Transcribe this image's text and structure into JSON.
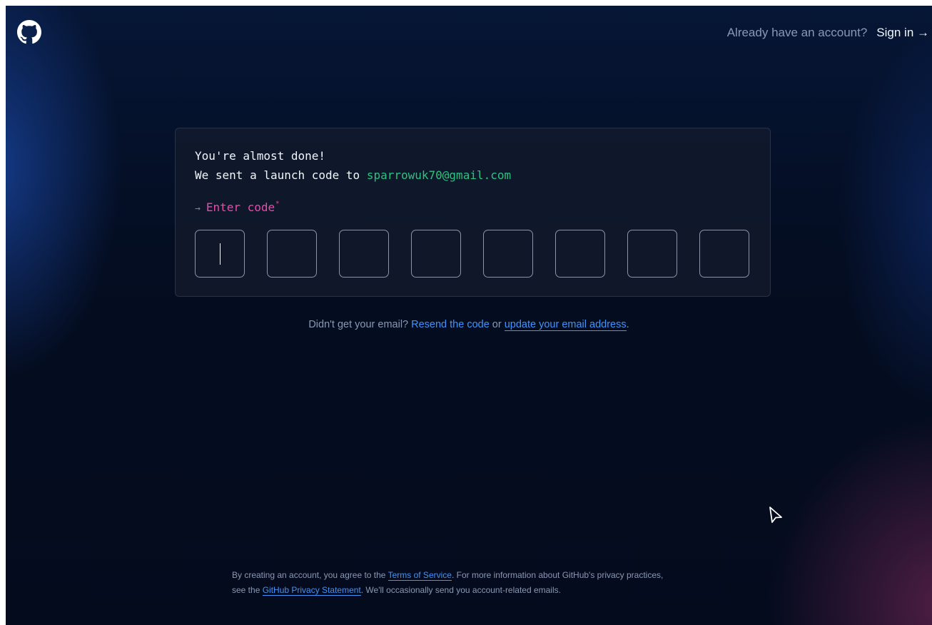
{
  "header": {
    "already_text": "Already have an account?",
    "signin_label": "Sign in →"
  },
  "card": {
    "line1": "You're almost done!",
    "line2_prefix": "We sent a launch code to ",
    "email": "sparrowuk70@gmail.com",
    "prompt_arrow": "→",
    "prompt_label": "Enter code",
    "required_mark": "*",
    "code_digits": [
      "",
      "",
      "",
      "",
      "",
      "",
      "",
      ""
    ]
  },
  "resend": {
    "prefix": "Didn't get your email? ",
    "resend_link": "Resend the code",
    "middle": " or ",
    "update_link": "update your email address",
    "suffix": "."
  },
  "footer": {
    "part1": "By creating an account, you agree to the ",
    "terms_link": "Terms of Service",
    "part2": ". For more information about GitHub's privacy practices,",
    "part3": "see the ",
    "privacy_link": "GitHub Privacy Statement",
    "part4": ". We'll occasionally send you account-related emails."
  },
  "colors": {
    "background": "#040d21",
    "email_green": "#2ec27e",
    "prompt_pink": "#ea4aaa",
    "link_blue": "#4493f8"
  },
  "icons": {
    "logo": "github-octocat-icon",
    "pointer": "mouse-pointer-icon"
  }
}
